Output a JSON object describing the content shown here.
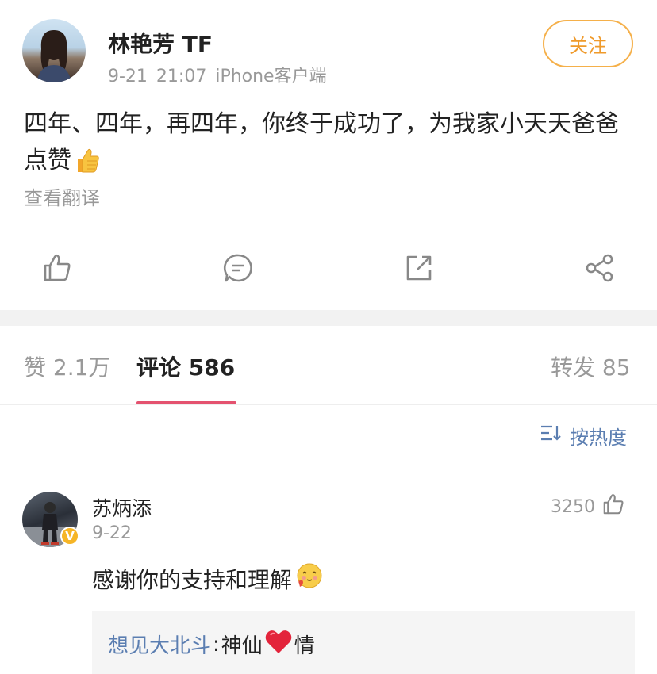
{
  "post": {
    "author": "林艳芳 TF",
    "date": "9-21 21:07",
    "client": "iPhone客户端",
    "follow_label": "关注",
    "text": "四年、四年，再四年，你终于成功了，为我家小天天爸爸点赞",
    "text_emoji": "thumbs-up-icon",
    "translate_label": "查看翻译"
  },
  "actions": [
    {
      "icon": "like-icon"
    },
    {
      "icon": "comment-icon"
    },
    {
      "icon": "repost-icon"
    },
    {
      "icon": "share-icon"
    }
  ],
  "tabs": {
    "likes": "赞 2.1万",
    "comments": "评论 586",
    "reposts": "转发 85"
  },
  "sort_label": "按热度",
  "comment": {
    "author": "苏炳添",
    "verified_badge": "V",
    "date": "9-22",
    "likes": "3250",
    "text": "感谢你的支持和理解",
    "emoji": "blushing-face-icon",
    "reply": {
      "author": "想见大北斗",
      "separator": ":",
      "text_before": " 神仙",
      "emoji": "red-heart-icon",
      "text_after": "情"
    }
  },
  "colors": {
    "accent_orange": "#ef9a2b",
    "link_blue": "#5b7eb1",
    "tab_underline": "#e4526f",
    "verified_gold": "#f6b526"
  }
}
